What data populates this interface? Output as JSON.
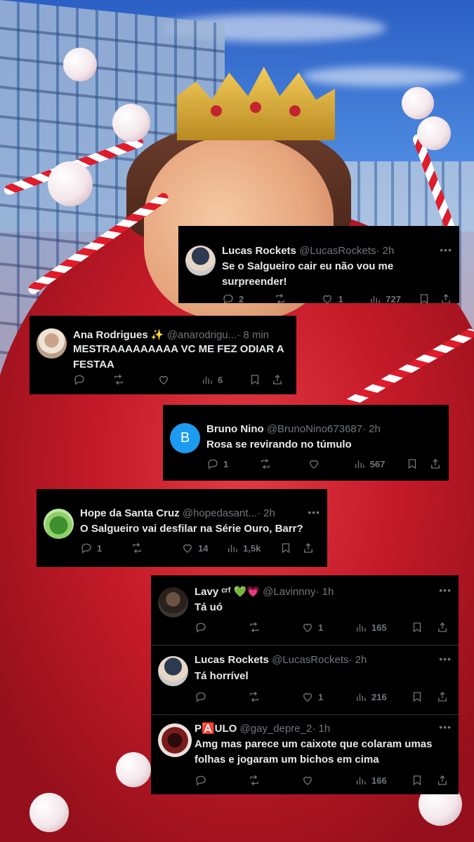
{
  "tweets": [
    {
      "name": "Lucas Rockets",
      "handle": "@LucasRockets",
      "time": "· 2h",
      "text": "Se o Salgueiro cair eu não vou me surpreender!",
      "replies": "2",
      "reposts": "",
      "likes": "1",
      "views": "727",
      "avatar": "photo"
    },
    {
      "name": "Ana Rodrigues ✨",
      "handle": "@anarodrigu...",
      "time": "· 8 min",
      "text": "MESTRAAAAAAAAA VC ME FEZ ODIAR A FESTAA",
      "replies": "",
      "reposts": "",
      "likes": "",
      "views": "6",
      "avatar": "photo"
    },
    {
      "name": "Bruno Nino",
      "handle": "@BrunoNino673687",
      "time": "· 2h",
      "text": "Rosa se revirando no túmulo",
      "replies": "1",
      "reposts": "",
      "likes": "",
      "views": "567",
      "avatar": "B",
      "avatar_color": "#1d9bf0"
    },
    {
      "name": "Hope da Santa Cruz",
      "handle": "@hopedasant...",
      "time": "· 2h",
      "text": "O Salgueiro vai desfilar na Série Ouro, Barr?",
      "replies": "1",
      "reposts": "",
      "likes": "14",
      "views": "1,5k",
      "avatar": "photo"
    },
    {
      "name": "Lavy ᶜʳᶠ 💚💗",
      "handle": "@Lavinnny",
      "time": "· 1h",
      "text": "Tá uó",
      "replies": "",
      "reposts": "",
      "likes": "1",
      "views": "165",
      "avatar": "photo"
    },
    {
      "name": "Lucas Rockets",
      "handle": "@LucasRockets",
      "time": "· 2h",
      "text": "Tá horrível",
      "replies": "",
      "reposts": "",
      "likes": "1",
      "views": "216",
      "avatar": "photo"
    },
    {
      "name": "P🅰️ULO",
      "handle": "@gay_depre_2",
      "time": "· 1h",
      "text": "Amg mas parece um caixote que colaram umas folhas e jogaram um bichos em cima",
      "replies": "",
      "reposts": "",
      "likes": "",
      "views": "166",
      "avatar": "photo"
    }
  ],
  "icons": {
    "more": "more-icon",
    "reply": "reply-icon",
    "repost": "repost-icon",
    "like": "like-icon",
    "views": "views-icon",
    "bookmark": "bookmark-icon",
    "share": "share-icon"
  },
  "colors": {
    "card_bg": "#000000",
    "text": "#e7e9ea",
    "muted": "#71767b",
    "separator": "#2f3336"
  }
}
